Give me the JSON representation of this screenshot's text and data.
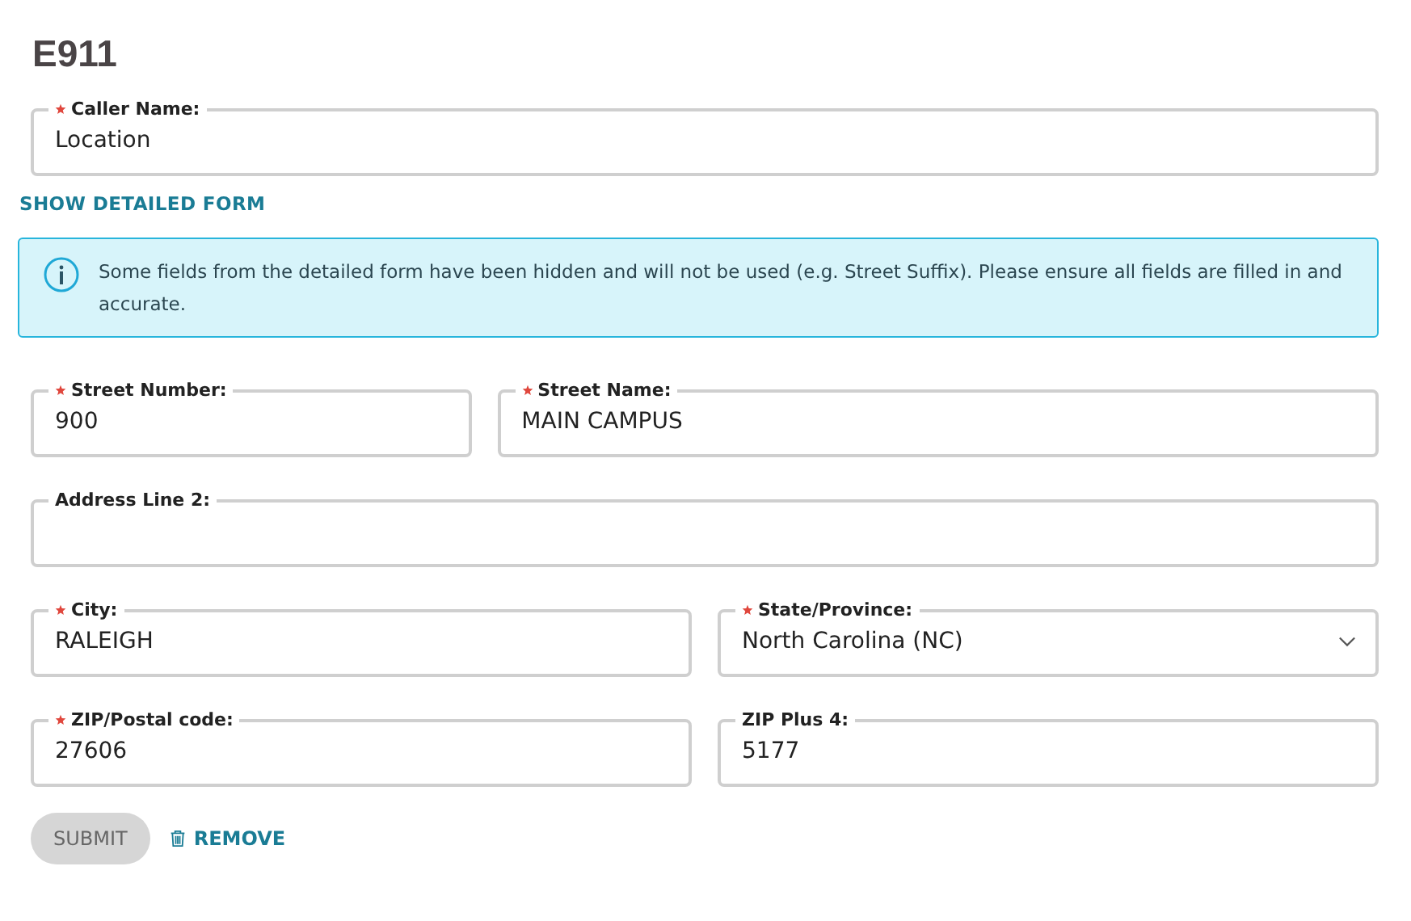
{
  "title": "E911",
  "caller": {
    "label": "Caller Name:",
    "value": "Location",
    "required": true,
    "kind": "text"
  },
  "detail_link": "SHOW DETAILED FORM",
  "notice": "Some fields from the detailed form have been hidden and will not be used (e.g. Street Suffix). Please ensure all fields are filled in and accurate.",
  "rows": [
    [
      {
        "label": "Street Number:",
        "value": "900",
        "required": true,
        "kind": "text"
      },
      {
        "label": "Street Name:",
        "value": "MAIN CAMPUS",
        "required": true,
        "kind": "text"
      }
    ],
    [
      {
        "label": "Address Line 2:",
        "required": false,
        "kind": "text"
      }
    ],
    [
      {
        "label": "City:",
        "value": "RALEIGH",
        "required": true,
        "kind": "text"
      },
      {
        "label": "State/Province:",
        "value": "North Carolina (NC)",
        "required": true,
        "kind": "select"
      }
    ],
    [
      {
        "label": "ZIP/Postal code:",
        "value": "27606",
        "required": true,
        "kind": "text"
      },
      {
        "label": "ZIP Plus 4:",
        "value": "5177",
        "required": false,
        "kind": "text"
      }
    ]
  ],
  "submit": {
    "label": "SUBMIT",
    "disabled": true
  },
  "remove": "REMOVE"
}
